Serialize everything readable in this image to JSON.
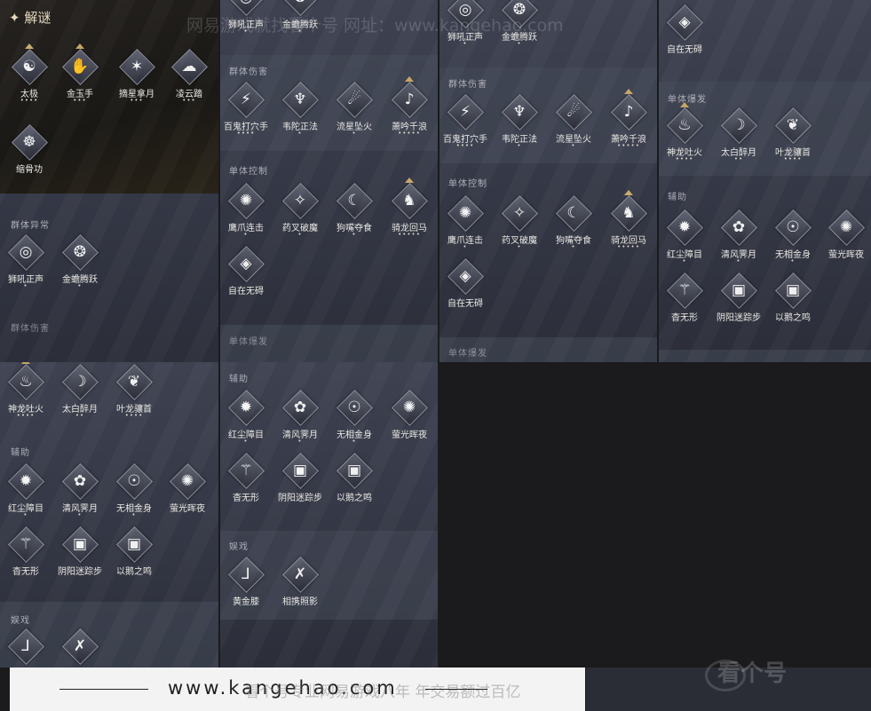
{
  "header": {
    "title": "解谜",
    "title_icon": "sparkle-icon"
  },
  "watermarks": {
    "top": "网易游戏就找看个号 网址：www.kangehao.com",
    "footer_url": "www.kangehao.com",
    "footer_slogan": "看个号专业网易游戏八年 年交易额过百亿",
    "logo": "看个号"
  },
  "labels": {
    "qun_yichang": "群体异常",
    "qun_shanghai": "群体伤害",
    "dan_kongzhi": "单体控制",
    "dan_baofa": "单体爆发",
    "fuzhu": "辅助",
    "xixi": "娱戏"
  },
  "skills": {
    "taiji": {
      "name": "太极",
      "stars": "••••",
      "icon": "taiji-icon"
    },
    "jinyu": {
      "name": "金玉手",
      "stars": "•••",
      "icon": "jade-hand-icon"
    },
    "zhaixing": {
      "name": "摘星拿月",
      "stars": "•••",
      "icon": "star-grab-icon"
    },
    "lingyun": {
      "name": "凌云踏",
      "stars": "•••",
      "icon": "cloud-step-icon"
    },
    "suogu": {
      "name": "缩骨功",
      "stars": "",
      "icon": "shrink-bone-icon"
    },
    "shihou": {
      "name": "狮吼正声",
      "stars": "•",
      "icon": "lion-roar-icon"
    },
    "jinchan": {
      "name": "金蟾腾跃",
      "stars": "•",
      "icon": "golden-toad-icon"
    },
    "baigui": {
      "name": "百鬼打穴手",
      "stars": "••••",
      "icon": "ghost-strike-icon"
    },
    "weituo": {
      "name": "韦陀正法",
      "stars": "•",
      "icon": "weituo-icon"
    },
    "liuxing": {
      "name": "流星坠火",
      "stars": "•",
      "icon": "meteor-fire-icon"
    },
    "xiaoyin": {
      "name": "萧吟千浪",
      "stars": "•••••",
      "icon": "flute-wave-icon"
    },
    "yingzhua": {
      "name": "鹰爪连击",
      "stars": "•",
      "icon": "eagle-claw-icon"
    },
    "yaocha": {
      "name": "药叉破魔",
      "stars": "•",
      "icon": "yaksha-icon"
    },
    "goumang": {
      "name": "狗嘴夺食",
      "stars": "•",
      "icon": "dog-snatch-icon"
    },
    "qilong": {
      "name": "骑龙回马",
      "stars": "•••••",
      "icon": "dragon-ride-icon"
    },
    "zizai": {
      "name": "自在无碍",
      "stars": "",
      "icon": "free-mind-icon"
    },
    "shenlong": {
      "name": "神龙吐火",
      "stars": "••••",
      "icon": "dragon-fire-icon"
    },
    "taibai": {
      "name": "太白醉月",
      "stars": "••",
      "icon": "drunk-moon-icon"
    },
    "yelong": {
      "name": "叶龙骧首",
      "stars": "••••",
      "icon": "leaf-dragon-icon"
    },
    "hongchen": {
      "name": "红尘障目",
      "stars": "•",
      "icon": "red-dust-icon"
    },
    "qingfeng": {
      "name": "清风霁月",
      "stars": "•",
      "icon": "breeze-moon-icon"
    },
    "wuxiang": {
      "name": "无相金身",
      "stars": "•",
      "icon": "golden-body-icon"
    },
    "yingguang": {
      "name": "萤光晖夜",
      "stars": "",
      "icon": "firefly-icon"
    },
    "xiangwu": {
      "name": "杳无形",
      "stars": "",
      "icon": "vanish-icon"
    },
    "yinyang": {
      "name": "阴阳迷踪步",
      "stars": "",
      "icon": "yinyang-step-icon"
    },
    "yi_e": {
      "name": "以鹅之鸣",
      "stars": "",
      "icon": "goose-call-icon"
    },
    "huangjin": {
      "name": "黄金膝",
      "stars": "",
      "icon": "golden-knee-icon"
    },
    "xiangxie": {
      "name": "相携照影",
      "stars": "",
      "icon": "twin-shadow-icon"
    }
  }
}
